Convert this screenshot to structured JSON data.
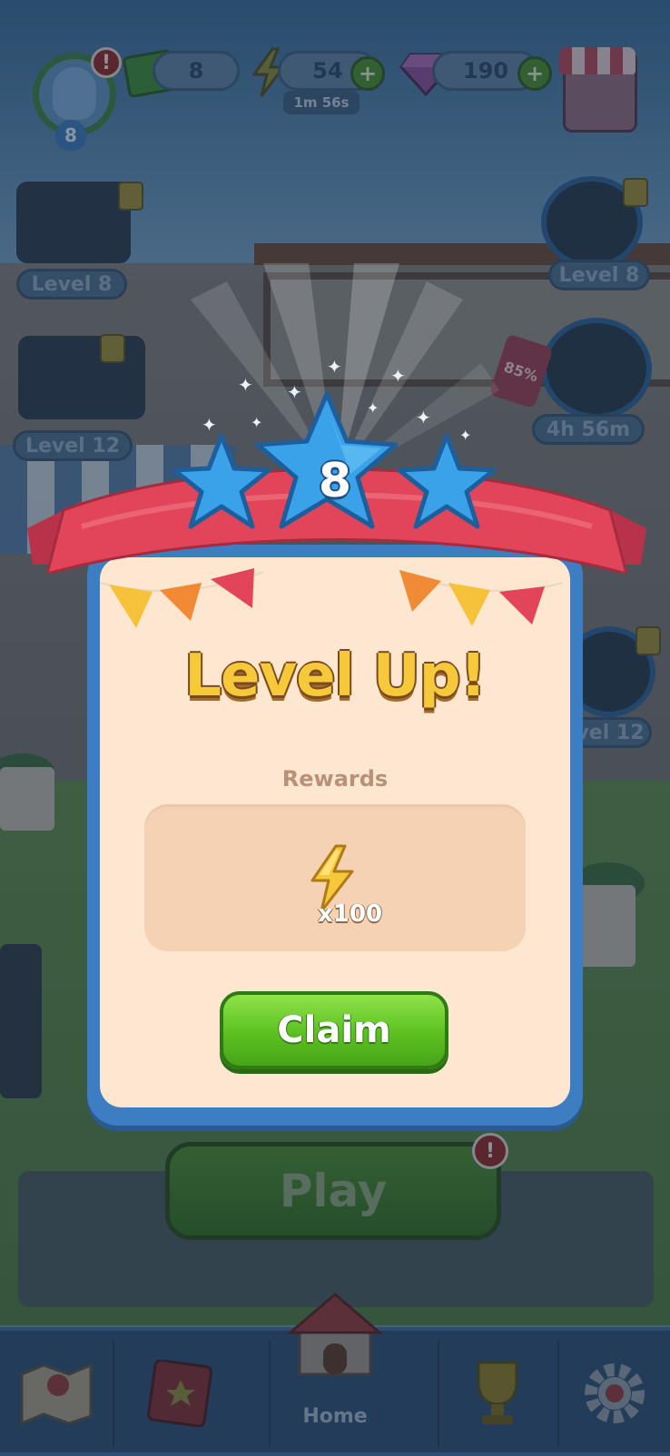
{
  "hud": {
    "cash_value": "8",
    "energy_value": "54",
    "energy_timer": "1m 56s",
    "gems_value": "190",
    "plus_label": "+",
    "player_level": "8",
    "alert_mark": "!"
  },
  "side_left": [
    {
      "label": "Level 8",
      "icon": "race-car-icon"
    },
    {
      "label": "Level 12",
      "icon": "teapot-icon"
    }
  ],
  "side_right": [
    {
      "label": "Level 8",
      "icon": "swirl-candy-icon"
    },
    {
      "label": "4h 56m",
      "icon": "energy-offer-icon",
      "discount": "85%"
    },
    {
      "label": "vel 12",
      "icon": "locked-item-icon"
    }
  ],
  "modal": {
    "level": "8",
    "title": "Level Up!",
    "rewards_label": "Rewards",
    "reward_quantity": "x100",
    "reward_icon": "lightning-bolt-icon",
    "claim_label": "Claim"
  },
  "play_button": {
    "label": "Play"
  },
  "bottom_nav": {
    "home_label": "Home",
    "items": [
      "map-icon",
      "album-book-icon",
      "home-icon",
      "trophy-icon",
      "settings-gear-icon"
    ]
  },
  "colors": {
    "claim_green": "#5cc020",
    "title_yellow": "#f6c93a",
    "modal_blue": "#3d7ec3",
    "modal_cream": "#fde7d0",
    "ribbon_red": "#e2455a"
  }
}
